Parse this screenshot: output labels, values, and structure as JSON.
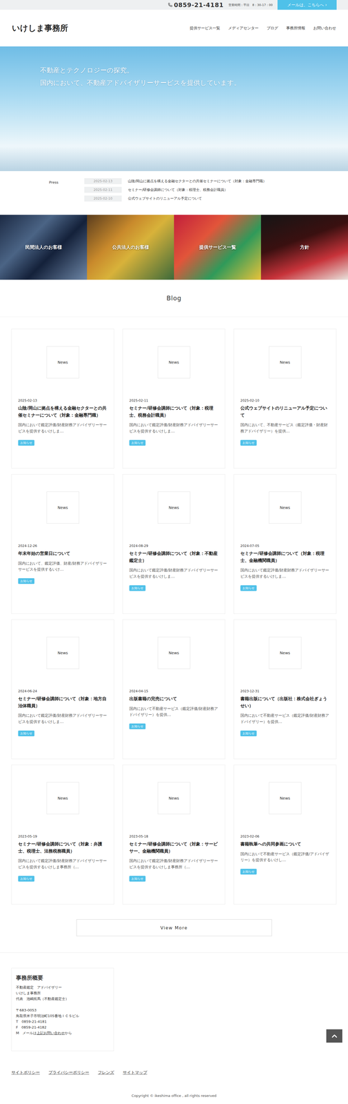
{
  "topbar": {
    "phone": "0859-21-4181",
    "hours": "営業時間：平日　8：30-17：00",
    "mail_button": "メールは、こちらへ ›"
  },
  "header": {
    "logo": "いけしま事務所",
    "nav": [
      "提供サービス一覧",
      "メディアセンター",
      "ブログ",
      "事務所情報",
      "お問い合わせ"
    ]
  },
  "hero": {
    "lines": [
      "不動産とテクノロジーの探究。",
      "国内において、不動産アドバイザリーサービスを提供しています。"
    ]
  },
  "press": {
    "label": "Press",
    "items": [
      {
        "date": "2025-02-13",
        "title": "山陰/岡山に拠点を構える金融セクターとの共催セミナーについて（対象：金融専門職）"
      },
      {
        "date": "2025-02-11",
        "title": "セミナー/研修会講師について（対象：税理士、税務会計職員）"
      },
      {
        "date": "2025-02-10",
        "title": "公式ウェブサイトのリニューアル予定について"
      }
    ]
  },
  "tiles": [
    {
      "label": "民間法人のお客様"
    },
    {
      "label": "公共法人のお客様"
    },
    {
      "label": "提供サービス一覧"
    },
    {
      "label": "方針"
    }
  ],
  "blog": {
    "heading": "Blog",
    "cards": [
      {
        "thumb": "News",
        "date": "2025-02-13",
        "title": "山陰/岡山に拠点を構える金融セクターとの共催セミナーについて（対象：金融専門職）",
        "excerpt": "国内において鑑定評価/財産財務アドバイザリーサービスを提供するいけしま…",
        "tag": "お知らせ"
      },
      {
        "thumb": "News",
        "date": "2025-02-11",
        "title": "セミナー/研修会講師について（対象：税理士、税務会計職員）",
        "excerpt": "国内において鑑定評価/財産財務アドバイザリーサービスを提供するいけしま…",
        "tag": "お知らせ"
      },
      {
        "thumb": "News",
        "date": "2025-02-10",
        "title": "公式ウェブサイトのリニューアル予定について",
        "excerpt": "国内において、不動産サービス（鑑定評価・財産財務アドバイザリー）を提供…",
        "tag": "お知らせ"
      },
      {
        "thumb": "News",
        "date": "2024-12-26",
        "title": "年末年始の営業日について",
        "excerpt": "国内において、鑑定評価、財産/財務アドバイザリーサービスを提供するいけ…",
        "tag": "お知らせ"
      },
      {
        "thumb": "News",
        "date": "2024-08-29",
        "title": "セミナー/研修会講師について（対象：不動産鑑定士）",
        "excerpt": "国内において鑑定評価/財産財務アドバイザリーサービスを提供するいけしま…",
        "tag": "お知らせ"
      },
      {
        "thumb": "News",
        "date": "2024-07-05",
        "title": "セミナー/研修会講師について（対象：税理士、金融機関職員）",
        "excerpt": "国内において鑑定評価/財産財務アドバイザリーサービスを提供するいけしま…",
        "tag": "お知らせ"
      },
      {
        "thumb": "News",
        "date": "2024-06-24",
        "title": "セミナー/研修会講師について（対象：地方自治体職員）",
        "excerpt": "国内において鑑定評価/財産財務アドバイザリーサービスを提供するいけしま…",
        "tag": "お知らせ"
      },
      {
        "thumb": "News",
        "date": "2024-04-15",
        "title": "出版書籍の完売について",
        "excerpt": "国内において不動産サービス（鑑定評価/財産財務アドバイザリー）を提供…",
        "tag": "お知らせ"
      },
      {
        "thumb": "News",
        "date": "2023-12-31",
        "title": "書籍出版について（出版社：株式会社ぎょうせい）",
        "excerpt": "国内において不動産サービス（鑑定評価/財産財務アドバイザリー）を提供…",
        "tag": "お知らせ"
      },
      {
        "thumb": "News",
        "date": "2023-05-19",
        "title": "セミナー/研修会講師について（対象：弁護士、税理士、法務税務職員）",
        "excerpt": "国内において鑑定評価/財産財務アドバイザリーサービスを提供するいけしま事務所（…",
        "tag": "お知らせ"
      },
      {
        "thumb": "News",
        "date": "2023-05-18",
        "title": "セミナー/研修会講師について（対象：サービサー、金融機関職員）",
        "excerpt": "国内において鑑定評価/財産財務アドバイザリーサービスを提供するいけしま事務所（…",
        "tag": "お知らせ"
      },
      {
        "thumb": "News",
        "date": "2023-02-06",
        "title": "書籍執筆への共同参画について",
        "excerpt": "国内において不動産サービス（鑑定評価/アドバイザリー）を提供するいけし…",
        "tag": "お知らせ"
      }
    ]
  },
  "view_more": "View More",
  "footer": {
    "office": {
      "title": "事務所概要",
      "lines_a": [
        "不動産鑑定　アドバイザリー",
        "いけしま事務所",
        "代表　池嶋拓馬（不動産鑑定士）"
      ],
      "lines_b": [
        "〒683-0053",
        "鳥取県米子市明治町105番地ＩＣＳビル",
        "T　0859-21-4181",
        "F　0859-21-4182"
      ],
      "mail_prefix": "M　メールは",
      "mail_link": "上記お問い合わせ",
      "mail_suffix": "から"
    },
    "links": [
      "サイトポリシー",
      "プライバシーポリシー",
      "フレンズ",
      "サイトマップ"
    ],
    "copyright": "Copyright © ikeshima office , all rights reserved"
  }
}
